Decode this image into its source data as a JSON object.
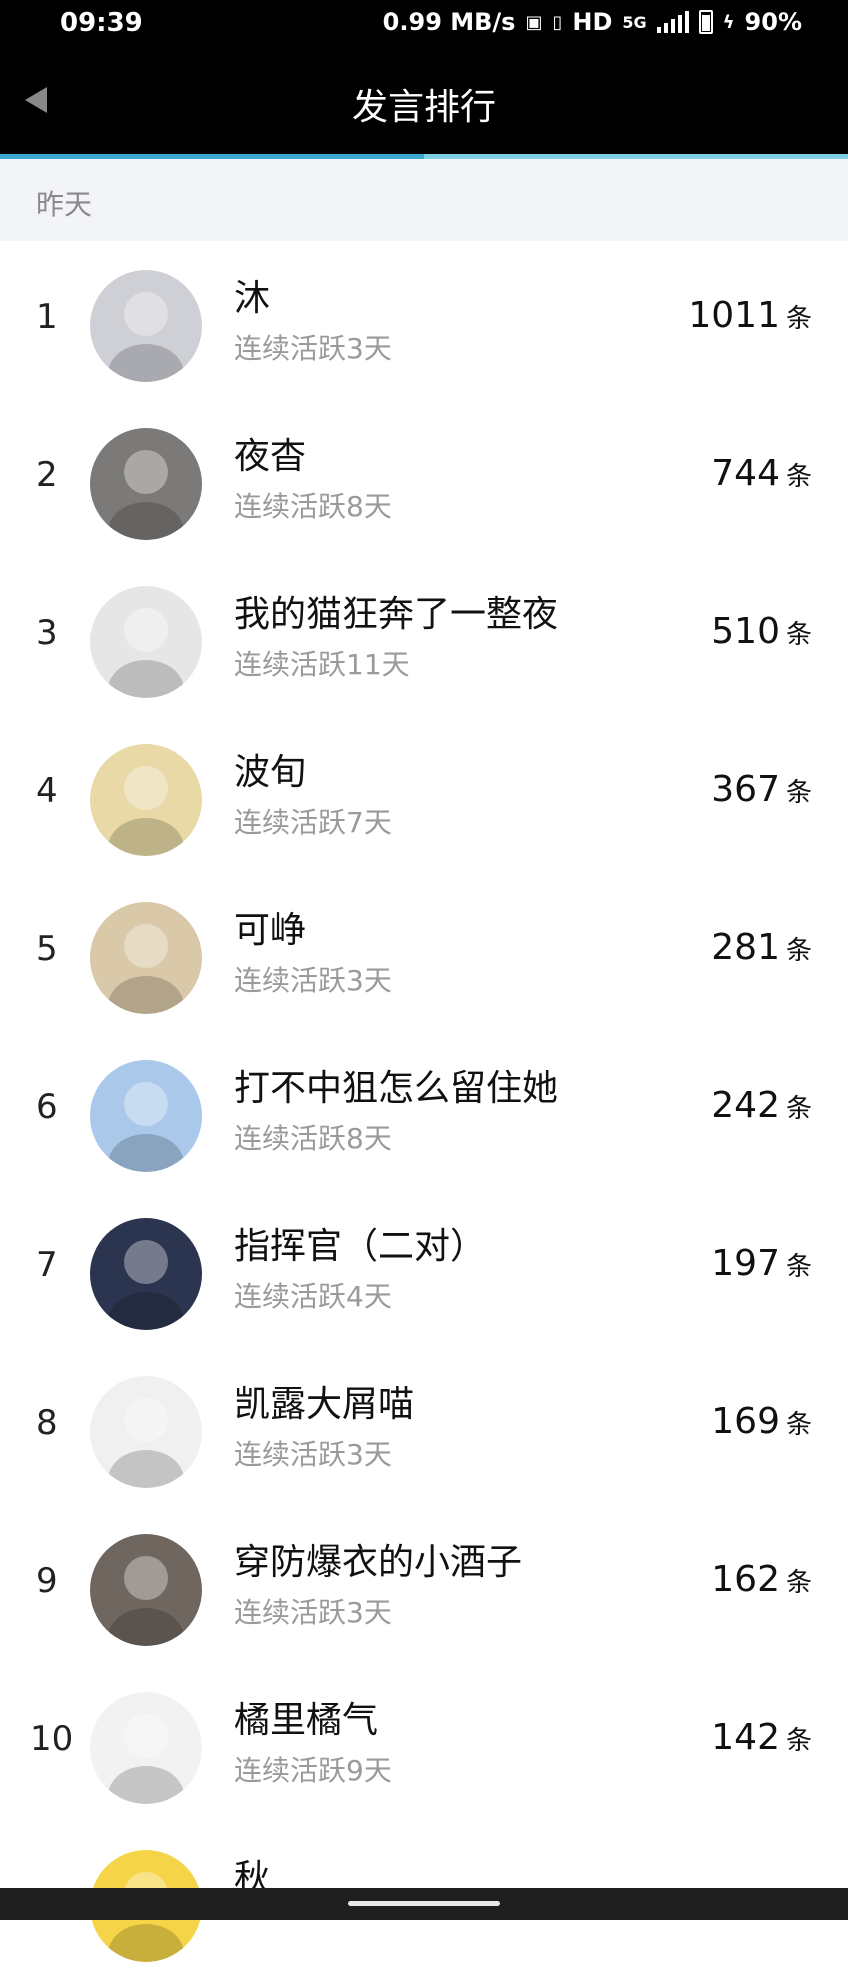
{
  "status_bar": {
    "time": "09:39",
    "speed": "0.99 MB/s",
    "network": "HD",
    "gen": "5G",
    "battery": "90%"
  },
  "app_bar": {
    "title": "发言排行",
    "back_icon": "back-triangle-icon",
    "tab_progress": 0.5
  },
  "section": {
    "label": "昨天"
  },
  "ranking": [
    {
      "rank": "1",
      "name": "沐",
      "streak": "连续活跃3天",
      "count": "1011",
      "unit": "条",
      "avatar_color": "#cfd0d6"
    },
    {
      "rank": "2",
      "name": "夜杳",
      "streak": "连续活跃8天",
      "count": "744",
      "unit": "条",
      "avatar_color": "#7c7a78"
    },
    {
      "rank": "3",
      "name": "我的猫狂奔了一整夜",
      "streak": "连续活跃11天",
      "count": "510",
      "unit": "条",
      "avatar_color": "#e6e6e6"
    },
    {
      "rank": "4",
      "name": "波旬",
      "streak": "连续活跃7天",
      "count": "367",
      "unit": "条",
      "avatar_color": "#e8d9a6"
    },
    {
      "rank": "5",
      "name": "可峥",
      "streak": "连续活跃3天",
      "count": "281",
      "unit": "条",
      "avatar_color": "#d9c9a8"
    },
    {
      "rank": "6",
      "name": "打不中狙怎么留住她",
      "streak": "连续活跃8天",
      "count": "242",
      "unit": "条",
      "avatar_color": "#a9c8ea"
    },
    {
      "rank": "7",
      "name": "指挥官（二对）",
      "streak": "连续活跃4天",
      "count": "197",
      "unit": "条",
      "avatar_color": "#2b3550"
    },
    {
      "rank": "8",
      "name": "凯露大屑喵",
      "streak": "连续活跃3天",
      "count": "169",
      "unit": "条",
      "avatar_color": "#f0f0f0"
    },
    {
      "rank": "9",
      "name": "穿防爆衣的小酒子",
      "streak": "连续活跃3天",
      "count": "162",
      "unit": "条",
      "avatar_color": "#6f6660"
    },
    {
      "rank": "10",
      "name": "橘里橘气",
      "streak": "连续活跃9天",
      "count": "142",
      "unit": "条",
      "avatar_color": "#f2f2f2"
    },
    {
      "rank": "",
      "name": "秋",
      "streak": "",
      "count": "",
      "unit": "",
      "avatar_color": "#f5d547"
    }
  ]
}
